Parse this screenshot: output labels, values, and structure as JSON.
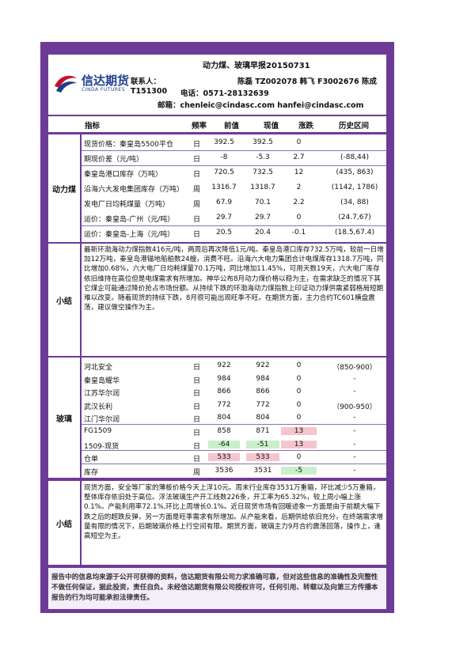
{
  "header": {
    "logo_cn": "信达期货",
    "logo_en": "CINDA FUTURES",
    "title": "动力煤、玻璃早报20150731",
    "contact_label": "联系人：",
    "contact_names": "陈磊 TZ002078   韩飞 F3002676   陈成",
    "contact_id": "T151300",
    "phone": "电话：0571-28132639",
    "email": "邮箱：chenleic@cindasc.com hanfei@cindasc.com"
  },
  "columns": {
    "indicator": "指标",
    "freq": "频率",
    "prev": "前值",
    "cur": "现值",
    "chg": "涨跌",
    "hist": "历史区间"
  },
  "coal": {
    "label": "动力煤",
    "rows": [
      {
        "name": "现货价格：秦皇岛5500平仓",
        "freq": "日",
        "prev": "392.5",
        "cur": "392.5",
        "chg": "0",
        "hist": ""
      },
      {
        "name": "期现价差（元/吨）",
        "freq": "日",
        "prev": "-8",
        "cur": "-5.3",
        "chg": "2.7",
        "hist": "(-88,44)"
      },
      {
        "name": "秦皇岛港口库存（万吨）",
        "freq": "日",
        "prev": "720.5",
        "cur": "732.5",
        "chg": "12",
        "hist": "(435, 863)"
      },
      {
        "name": "沿海六大发电集团库存（万吨）",
        "freq": "周",
        "prev": "1316.7",
        "cur": "1318.7",
        "chg": "2",
        "hist": "(1142, 1786)"
      },
      {
        "name": "发电厂日均耗煤量（万吨）",
        "freq": "周",
        "prev": "67.9",
        "cur": "70.1",
        "chg": "2.2",
        "hist": "(34, 88)"
      },
      {
        "name": "运价：秦皇岛-广州（元/吨）",
        "freq": "日",
        "prev": "29.7",
        "cur": "29.7",
        "chg": "0",
        "hist": "(24.7,67)"
      },
      {
        "name": "运价：秦皇岛-上海（元/吨）",
        "freq": "日",
        "prev": "20.5",
        "cur": "20.4",
        "chg": "-0.1",
        "hist": "(18.5,67.4)"
      }
    ]
  },
  "coal_summary": {
    "label": "小结",
    "text": "最新环渤海动力煤指数416元/吨，两周后再次降低1元/吨。秦皇岛港口库存732.5万吨，较前一日增加12万吨，秦皇岛港锚地船舶数24艘，消费不旺。沿海六大电力集团合计电煤库存1318.7万吨，同比增加0.68%，六大电厂日均耗煤量70.1万吨，同比增加11.45%，可用天数19天，六大电厂库存依旧维持在高位但是电煤需求有所增加。神华公布8月动力煤价格以稳为主，在需求缺乏的情况下其它煤企可能通过降价抢占市场份额。从持续下跌的环渤海动力煤指数上印证动力煤供需紧弱格局短期难以改变。随着现货的持续下跌，8月很可能出现旺季不旺。在期货方面，主力合约TC601横盘震荡，建议做空操作为主。"
  },
  "glass": {
    "label": "玻璃",
    "rows": [
      {
        "name": "河北安全",
        "freq": "日",
        "prev": "922",
        "cur": "922",
        "chg": "0",
        "hist": "（850-900）"
      },
      {
        "name": "秦皇岛耀华",
        "freq": "日",
        "prev": "984",
        "cur": "984",
        "chg": "0",
        "hist": "-"
      },
      {
        "name": "江苏华尔润",
        "freq": "日",
        "prev": "866",
        "cur": "866",
        "chg": "0",
        "hist": "-"
      },
      {
        "name": "武汉长利",
        "freq": "日",
        "prev": "772",
        "cur": "772",
        "chg": "0",
        "hist": "（900-950）"
      },
      {
        "name": "江门华尔润",
        "freq": "日",
        "prev": "804",
        "cur": "804",
        "chg": "0",
        "hist": "-"
      },
      {
        "name": "FG1509",
        "freq": "日",
        "prev": "858",
        "cur": "871",
        "chg": "13",
        "hist": "-"
      },
      {
        "name": "1509-现货",
        "freq": "日",
        "prev": "-64",
        "cur": "-51",
        "chg": "13",
        "hist": "-"
      },
      {
        "name": "仓单",
        "freq": "日",
        "prev": "533",
        "cur": "533",
        "chg": "0",
        "hist": "-"
      },
      {
        "name": "库存",
        "freq": "周",
        "prev": "3536",
        "cur": "3531",
        "chg": "-5",
        "hist": "-"
      }
    ]
  },
  "glass_summary": {
    "label": "小结",
    "text": "现货方面，安全等厂家的薄板价格今天上浮10元。周末行业库存3531万重箱，环比减少5万重箱，整体库存依旧处于高位。浮法玻璃生产开工线数226条，开工率为65.32%，较上周小幅上涨0.1%。产能利用率72.1%,环比上周增长0.1%。近日现货市场有回暖迹象一方面是由于前期大幅下跌之后的超跌反弹，另一方面是旺季需求有所增加。从产能来看，后期供给依旧充分，在终端需求增量有限的情况下，后期玻璃价格上行空间有限。期货方面，玻璃主力9月合约震荡回落，操作上，逢高短空为主。"
  },
  "disclaimer": "报告中的信息均来源于公开可获得的资料，信达期货有限公司力求准确可靠，但对这些信息的准确性及完整性不做任何保证，据此投资，责任自负。未经信达期货有限公司授权许可，任何引用、转载以及向第三方传播本报告的行为均可能承担法律责任。",
  "colors": {
    "frame": "#6d3a98",
    "increase": "#f4c6cc",
    "decrease": "#c9efcb"
  }
}
